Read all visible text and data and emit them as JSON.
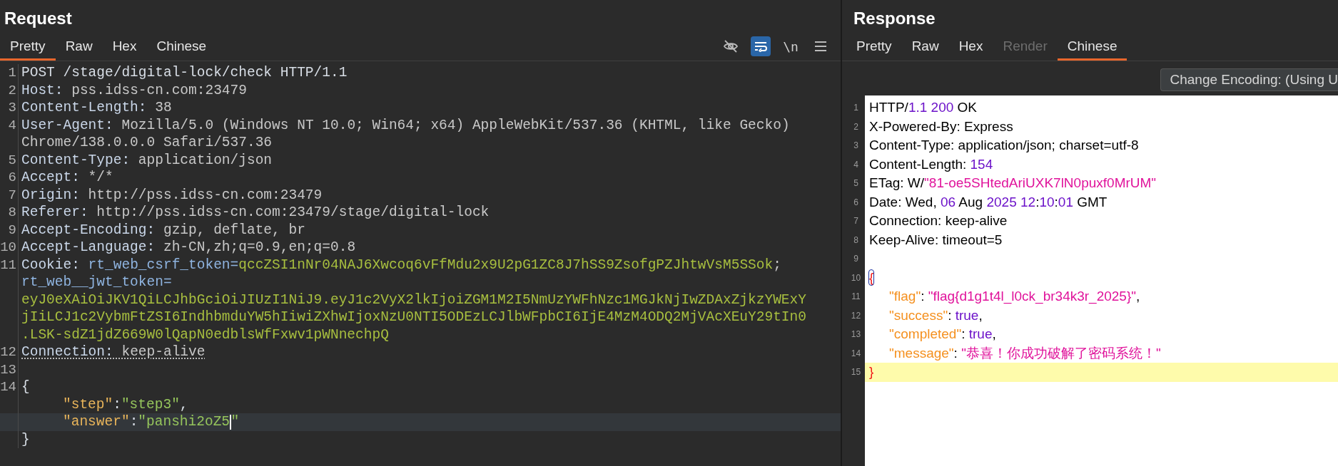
{
  "request": {
    "title": "Request",
    "tabs": [
      {
        "label": "Pretty",
        "selected": true,
        "disabled": false
      },
      {
        "label": "Raw",
        "selected": false,
        "disabled": false
      },
      {
        "label": "Hex",
        "selected": false,
        "disabled": false
      },
      {
        "label": "Chinese",
        "selected": false,
        "disabled": false
      }
    ],
    "toolbar": [
      {
        "kind": "hide-icon",
        "selected": false
      },
      {
        "kind": "wrap-icon",
        "selected": true
      },
      {
        "kind": "text",
        "label": "\\n",
        "selected": false
      },
      {
        "kind": "menu-icon",
        "selected": false
      }
    ],
    "rows": [
      {
        "number": "1",
        "tokens": [
          {
            "kind": "plain",
            "text": "POST /stage/digital-lock/check HTTP/1.1"
          }
        ]
      },
      {
        "number": "2",
        "tokens": [
          {
            "kind": "name",
            "text": "Host:"
          },
          {
            "kind": "value",
            "text": " pss.idss-cn.com:23479"
          }
        ]
      },
      {
        "number": "3",
        "tokens": [
          {
            "kind": "name",
            "text": "Content-Length:"
          },
          {
            "kind": "value",
            "text": " 38"
          }
        ]
      },
      {
        "number": "4",
        "tokens": [
          {
            "kind": "name",
            "text": "User-Agent:"
          },
          {
            "kind": "value",
            "text": " Mozilla/5.0 (Windows NT 10.0; Win64; x64) AppleWebKit/537.36 (KHTML, like Gecko)"
          }
        ]
      },
      {
        "tokens": [
          {
            "kind": "value",
            "text": "Chrome/138.0.0.0 Safari/537.36"
          }
        ]
      },
      {
        "number": "5",
        "tokens": [
          {
            "kind": "name",
            "text": "Content-Type:"
          },
          {
            "kind": "value",
            "text": " application/json"
          }
        ]
      },
      {
        "number": "6",
        "tokens": [
          {
            "kind": "name",
            "text": "Accept:"
          },
          {
            "kind": "value",
            "text": " */*"
          }
        ]
      },
      {
        "number": "7",
        "tokens": [
          {
            "kind": "name",
            "text": "Origin:"
          },
          {
            "kind": "value",
            "text": " http://pss.idss-cn.com:23479"
          }
        ]
      },
      {
        "number": "8",
        "tokens": [
          {
            "kind": "name",
            "text": "Referer:"
          },
          {
            "kind": "value",
            "text": " http://pss.idss-cn.com:23479/stage/digital-lock"
          }
        ]
      },
      {
        "number": "9",
        "tokens": [
          {
            "kind": "name",
            "text": "Accept-Encoding:"
          },
          {
            "kind": "value",
            "text": " gzip, deflate, br"
          }
        ]
      },
      {
        "number": "10",
        "tokens": [
          {
            "kind": "name",
            "text": "Accept-Language:"
          },
          {
            "kind": "value",
            "text": " zh-CN,zh;q=0.9,en;q=0.8"
          }
        ]
      },
      {
        "number": "11",
        "tokens": [
          {
            "kind": "name",
            "text": "Cookie:"
          },
          {
            "kind": "cookie-name",
            "text": " rt_web_csrf_token="
          },
          {
            "kind": "cookie-value",
            "text": "qccZSI1nNr04NAJ6Xwcoq6vFfMdu2x9U2pG1ZC8J7hSS9ZsofgPZJhtwVsM5SSok"
          },
          {
            "kind": "value",
            "text": ";"
          }
        ]
      },
      {
        "tokens": [
          {
            "kind": "cookie-name",
            "text": "rt_web__jwt_token="
          }
        ]
      },
      {
        "tokens": [
          {
            "kind": "cookie-value",
            "text": "eyJ0eXAiOiJKV1QiLCJhbGciOiJIUzI1NiJ9.eyJ1c2VyX2lkIjoiZGM1M2I5NmUzYWFhNzc1MGJkNjIwZDAxZjkzYWExY"
          }
        ]
      },
      {
        "tokens": [
          {
            "kind": "cookie-value",
            "text": "jIiLCJ1c2VybmFtZSI6IndhbmduYW5hIiwiZXhwIjoxNzU0NTI5ODEzLCJlbWFpbCI6IjE4MzM4ODQ2MjVAcXEuY29tIn0"
          }
        ]
      },
      {
        "tokens": [
          {
            "kind": "cookie-value",
            "text": ".LSK-sdZ1jdZ669W0lQapN0edblsWfFxwv1pWNnechpQ"
          }
        ]
      },
      {
        "number": "12",
        "underlined": true,
        "tokens": [
          {
            "kind": "name",
            "text": "Connection:"
          },
          {
            "kind": "value",
            "text": " keep-alive"
          }
        ]
      },
      {
        "number": "13",
        "tokens": []
      },
      {
        "number": "14",
        "tokens": [
          {
            "kind": "plain",
            "text": "{"
          }
        ]
      },
      {
        "indent": true,
        "tokens": [
          {
            "kind": "key",
            "text": "\"step\""
          },
          {
            "kind": "plain",
            "text": ":"
          },
          {
            "kind": "string",
            "text": "\"step3\""
          },
          {
            "kind": "plain",
            "text": ","
          }
        ]
      },
      {
        "indent": true,
        "current": true,
        "tokens": [
          {
            "kind": "key",
            "text": "\"answer\""
          },
          {
            "kind": "plain",
            "text": ":"
          },
          {
            "kind": "string",
            "text": "\"panshi2oZ5"
          },
          {
            "kind": "caret"
          },
          {
            "kind": "string",
            "text": "\""
          }
        ]
      },
      {
        "tokens": [
          {
            "kind": "plain",
            "text": "}"
          }
        ]
      }
    ]
  },
  "response": {
    "title": "Response",
    "tabs": [
      {
        "label": "Pretty",
        "selected": false,
        "disabled": false
      },
      {
        "label": "Raw",
        "selected": false,
        "disabled": false
      },
      {
        "label": "Hex",
        "selected": false,
        "disabled": false
      },
      {
        "label": "Render",
        "selected": false,
        "disabled": true
      },
      {
        "label": "Chinese",
        "selected": true,
        "disabled": false
      }
    ],
    "encoding_button": "Change Encoding: (Using U",
    "rows": [
      {
        "number": "1",
        "tokens": [
          {
            "kind": "plain",
            "text": "HTTP/"
          },
          {
            "kind": "number",
            "text": "1.1 200"
          },
          {
            "kind": "plain",
            "text": " OK"
          }
        ]
      },
      {
        "number": "2",
        "tokens": [
          {
            "kind": "plain",
            "text": "X-Powered-By: Express"
          }
        ]
      },
      {
        "number": "3",
        "tokens": [
          {
            "kind": "plain",
            "text": "Content-Type: application/json; charset=utf-8"
          }
        ]
      },
      {
        "number": "4",
        "tokens": [
          {
            "kind": "plain",
            "text": "Content-Length: "
          },
          {
            "kind": "number",
            "text": "154"
          }
        ]
      },
      {
        "number": "5",
        "tokens": [
          {
            "kind": "plain",
            "text": "ETag: W/"
          },
          {
            "kind": "string",
            "text": "\"81-oe5SHtedAriUXK7lN0puxf0MrUM\""
          }
        ]
      },
      {
        "number": "6",
        "tokens": [
          {
            "kind": "plain",
            "text": "Date: Wed, "
          },
          {
            "kind": "number",
            "text": "06"
          },
          {
            "kind": "plain",
            "text": " Aug "
          },
          {
            "kind": "number",
            "text": "2025 12"
          },
          {
            "kind": "plain",
            "text": ":"
          },
          {
            "kind": "number",
            "text": "10"
          },
          {
            "kind": "plain",
            "text": ":"
          },
          {
            "kind": "number",
            "text": "01"
          },
          {
            "kind": "plain",
            "text": " GMT"
          }
        ]
      },
      {
        "number": "7",
        "tokens": [
          {
            "kind": "plain",
            "text": "Connection: keep-alive"
          }
        ]
      },
      {
        "number": "8",
        "tokens": [
          {
            "kind": "plain",
            "text": "Keep-Alive: timeout=5"
          }
        ]
      },
      {
        "number": "9",
        "tokens": []
      },
      {
        "number": "10",
        "tokens": [
          {
            "kind": "brace",
            "text": "{",
            "matched": true
          }
        ]
      },
      {
        "number": "11",
        "indent": true,
        "tokens": [
          {
            "kind": "key",
            "text": "\"flag\""
          },
          {
            "kind": "plain",
            "text": ": "
          },
          {
            "kind": "string",
            "text": "\"flag{d1g1t4l_l0ck_br34k3r_2025}\""
          },
          {
            "kind": "plain",
            "text": ","
          }
        ]
      },
      {
        "number": "12",
        "indent": true,
        "tokens": [
          {
            "kind": "key",
            "text": "\"success\""
          },
          {
            "kind": "plain",
            "text": ": "
          },
          {
            "kind": "number",
            "text": "true"
          },
          {
            "kind": "plain",
            "text": ","
          }
        ]
      },
      {
        "number": "13",
        "indent": true,
        "tokens": [
          {
            "kind": "key",
            "text": "\"completed\""
          },
          {
            "kind": "plain",
            "text": ": "
          },
          {
            "kind": "number",
            "text": "true"
          },
          {
            "kind": "plain",
            "text": ","
          }
        ]
      },
      {
        "number": "14",
        "indent": true,
        "tokens": [
          {
            "kind": "key",
            "text": "\"message\""
          },
          {
            "kind": "plain",
            "text": ": "
          },
          {
            "kind": "string",
            "text": "\"恭喜！你成功破解了密码系统！\""
          }
        ]
      },
      {
        "number": "15",
        "current": true,
        "tokens": [
          {
            "kind": "brace",
            "text": "}",
            "matched": false
          }
        ]
      }
    ]
  }
}
